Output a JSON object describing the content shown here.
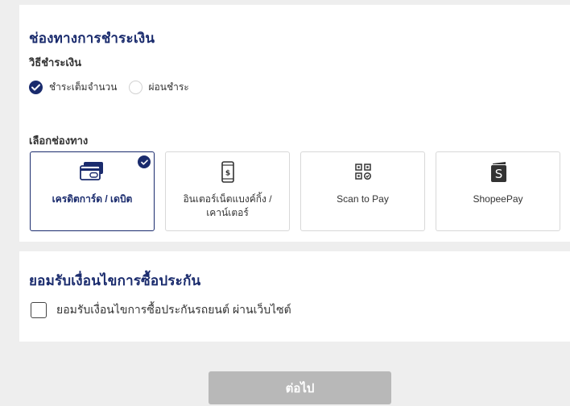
{
  "payment_section": {
    "title": "ช่องทางการชำระเงิน",
    "method_label": "วิธีชำระเงิน",
    "methods": [
      {
        "label": "ชำระเต็มจำนวน",
        "checked": true
      },
      {
        "label": "ผ่อนชำระ",
        "checked": false
      }
    ],
    "channel_label": "เลือกช่องทาง",
    "channels": [
      {
        "label": "เครดิตการ์ด / เดบิต",
        "icon": "credit-card-icon",
        "selected": true
      },
      {
        "label": "อินเตอร์เน็ตแบงค์กิ้ง / เคาน์เตอร์",
        "icon": "mobile-banking-icon",
        "selected": false
      },
      {
        "label": "Scan to Pay",
        "icon": "qr-code-icon",
        "selected": false
      },
      {
        "label": "ShopeePay",
        "icon": "shopeepay-icon",
        "selected": false
      }
    ]
  },
  "consent_section": {
    "title": "ยอมรับเงื่อนไขการซื้อประกัน",
    "checkbox_label": "ยอมรับเงื่อนไขการซื้อประกันรถยนต์ ผ่านเว็บไซต์",
    "checked": false
  },
  "next_button": {
    "label": "ต่อไป",
    "disabled": true
  },
  "colors": {
    "primary": "#1a2b6d",
    "background": "#eeeeee",
    "disabled_button": "#b8b8b8",
    "shopeepay_icon": "#333333"
  }
}
